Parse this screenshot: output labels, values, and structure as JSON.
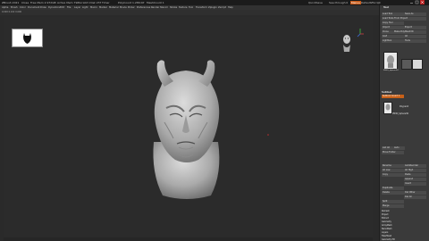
{
  "titlebar": {
    "app": "ZBrush 2021",
    "items": [
      "Close",
      "Free Mem 2.972GB",
      "Active Mem 796",
      "Scratch Disk 237",
      "Timer",
      "PolyCount 1.286 KP",
      "MeshCount 1"
    ],
    "right": [
      "QuickSave",
      "See-through 0",
      "Menus",
      "DefaultZScript"
    ]
  },
  "menubar": {
    "items": [
      "Alpha",
      "Brush",
      "Color",
      "Document",
      "Draw",
      "Dynamics",
      "Edit",
      "File",
      "Layer",
      "Light",
      "Macro",
      "Marker",
      "Material",
      "Movie",
      "Picker",
      "Preferences",
      "Render",
      "Stencil",
      "Stroke",
      "Texture",
      "Tool",
      "Transform",
      "Zplugin",
      "Zscript",
      "Help"
    ]
  },
  "subbar": {
    "text": "0.000 0.102 0.000"
  },
  "panel": {
    "header": "Tool",
    "buttons": [
      [
        "Load Tool",
        "Save As"
      ],
      [
        "Load Tools From Project",
        ""
      ],
      [
        "Copy Tool",
        ""
      ],
      [
        "Import",
        "Export"
      ],
      [
        "Clone",
        "Make PolyMesh3D"
      ],
      [
        "GoZ",
        "All"
      ],
      [
        "Lightbox",
        "Tools"
      ]
    ],
    "model_name": "PM3D_Sphere3D",
    "subtool_header": "Subtool",
    "subtool_tabs": [
      "Subtool Count 1"
    ],
    "polypaint_label": "Polypaint",
    "polypaint_item": "PM3D_Sphere3D",
    "list_buttons": [
      [
        "List All",
        "Auto"
      ],
      [
        "Move Folder",
        ""
      ]
    ],
    "more_buttons": [
      [
        "Rename",
        "AutoReorder"
      ],
      [
        "All Low",
        "All High"
      ],
      [
        "Copy",
        "Paste"
      ],
      [
        "Append",
        ""
      ],
      [
        "Insert",
        ""
      ],
      [
        "Duplicate",
        ""
      ],
      [
        "Delete",
        "Del Other"
      ],
      [
        "",
        "Del All"
      ],
      [
        "Split",
        ""
      ],
      [
        "Merge",
        ""
      ]
    ],
    "bottom_items": [
      "Remesh",
      "Project",
      "Extract",
      "Geometry",
      "ArrayMesh",
      "NanoMesh",
      "Layers",
      "FiberMesh",
      "Geometry HD",
      "Preview",
      "Surface",
      "Deformation",
      "Masking",
      "Visibility",
      "Polygroups",
      "Contact",
      "Morph Target",
      "Polypaint",
      "UV Map"
    ]
  },
  "colors": {
    "bg": "#2a2a2a",
    "panel": "#3a3a3a",
    "model": "#b9b9b9",
    "accent_orange": "#e07020"
  },
  "icons": [
    "close-icon",
    "minimize-icon",
    "maximize-icon",
    "nav-cube-icon",
    "axis-gizmo-icon"
  ]
}
